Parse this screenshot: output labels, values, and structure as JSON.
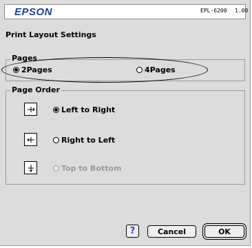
{
  "header": {
    "brand": "EPSON",
    "model": "EPL-6200",
    "version": "1.00"
  },
  "title": "Print Layout Settings",
  "pages": {
    "label": "Pages",
    "options": [
      {
        "label": "2Pages",
        "selected": true
      },
      {
        "label": "4Pages",
        "selected": false
      }
    ]
  },
  "page_order": {
    "label": "Page Order",
    "options": [
      {
        "label": "Left to Right",
        "selected": true,
        "enabled": true,
        "icon": "arrow-right-page-icon"
      },
      {
        "label": "Right to Left",
        "selected": false,
        "enabled": true,
        "icon": "arrow-left-page-icon"
      },
      {
        "label": "Top to Bottom",
        "selected": false,
        "enabled": false,
        "icon": "arrow-down-page-icon"
      }
    ]
  },
  "buttons": {
    "help": "?",
    "cancel": "Cancel",
    "ok": "OK"
  },
  "colors": {
    "brand": "#1f3f9e",
    "dialog_bg": "#dcdcdc",
    "help_icon": "#2b3fd0",
    "disabled_text": "#9a9a9a"
  }
}
